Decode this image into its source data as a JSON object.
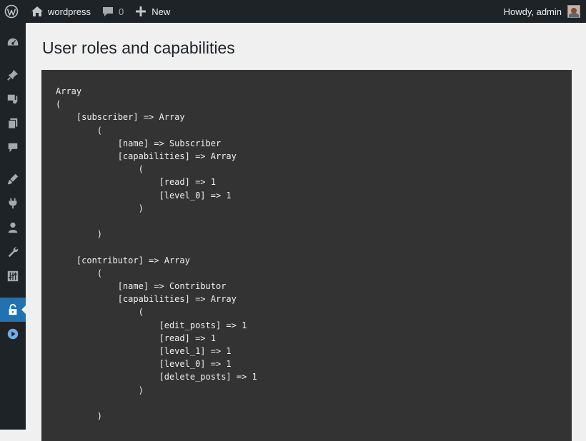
{
  "adminbar": {
    "site_name": "wordpress",
    "comments_count": "0",
    "new_label": "New",
    "howdy": "Howdy, admin",
    "icons": [
      "wordpress-logo-icon",
      "home-icon",
      "comment-icon",
      "plus-icon",
      "avatar"
    ]
  },
  "sidebar": {
    "items": [
      {
        "name": "dashboard-icon"
      },
      {
        "name": "posts-pin-icon"
      },
      {
        "name": "media-icon"
      },
      {
        "name": "pages-icon"
      },
      {
        "name": "comments-icon"
      },
      {
        "name": "appearance-brush-icon"
      },
      {
        "name": "plugins-icon"
      },
      {
        "name": "users-icon"
      },
      {
        "name": "tools-wrench-icon"
      },
      {
        "name": "settings-sliders-icon"
      },
      {
        "name": "lock-icon",
        "active": true
      },
      {
        "name": "play-circle-icon"
      }
    ],
    "active_color": "#2271b1"
  },
  "main": {
    "title": "User roles and capabilities",
    "code": "Array\n(\n    [subscriber] => Array\n        (\n            [name] => Subscriber\n            [capabilities] => Array\n                (\n                    [read] => 1\n                    [level_0] => 1\n                )\n\n        )\n\n    [contributor] => Array\n        (\n            [name] => Contributor\n            [capabilities] => Array\n                (\n                    [edit_posts] => 1\n                    [read] => 1\n                    [level_1] => 1\n                    [level_0] => 1\n                    [delete_posts] => 1\n                )\n\n        )"
  }
}
